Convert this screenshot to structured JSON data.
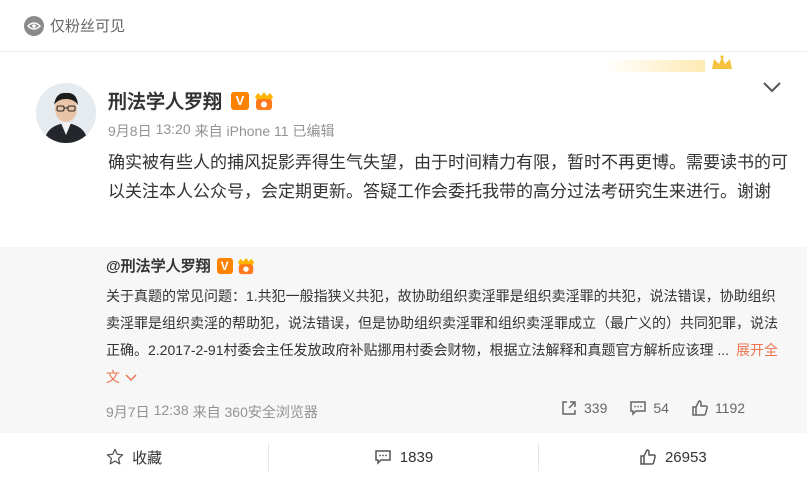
{
  "visibility": {
    "label": "仅粉丝可见",
    "icon": "eye-icon"
  },
  "post": {
    "author": "刑法学人罗翔",
    "verified_badge": "V",
    "meta": {
      "date": "9月8日",
      "time": "13:20",
      "source": "来自 iPhone 11",
      "edited": "已编辑"
    },
    "text": "确实被有些人的捕风捉影弄得生气失望，由于时间精力有限，暂时不再更博。需要读书的可以关注本人公众号，会定期更新。答疑工作会委托我带的高分过法考研究生来进行。谢谢"
  },
  "repost": {
    "author": "@刑法学人罗翔",
    "verified_badge": "V",
    "text": "关于真题的常见问题：1.共犯一般指狭义共犯，故协助组织卖淫罪是组织卖淫罪的共犯，说法错误，协助组织卖淫罪是组织卖淫的帮助犯，说法错误，但是协助组织卖淫罪和组织卖淫罪成立（最广义的）共同犯罪，说法正确。2.2017-2-91村委会主任发放政府补贴挪用村委会财物，根据立法解释和真题官方解析应该理 ...",
    "expand_label": "展开全文",
    "meta": {
      "date": "9月7日",
      "time": "12:38",
      "source": "来自 360安全浏览器"
    },
    "actions": {
      "reposts": "339",
      "comments": "54",
      "likes": "1192"
    }
  },
  "toolbar": {
    "favorite_label": "收藏",
    "comments": "1839",
    "likes": "26953"
  },
  "colors": {
    "accent_orange": "#ff8200",
    "link": "#eb7350",
    "muted": "#939393",
    "repost_bg": "#f7f7f7"
  }
}
